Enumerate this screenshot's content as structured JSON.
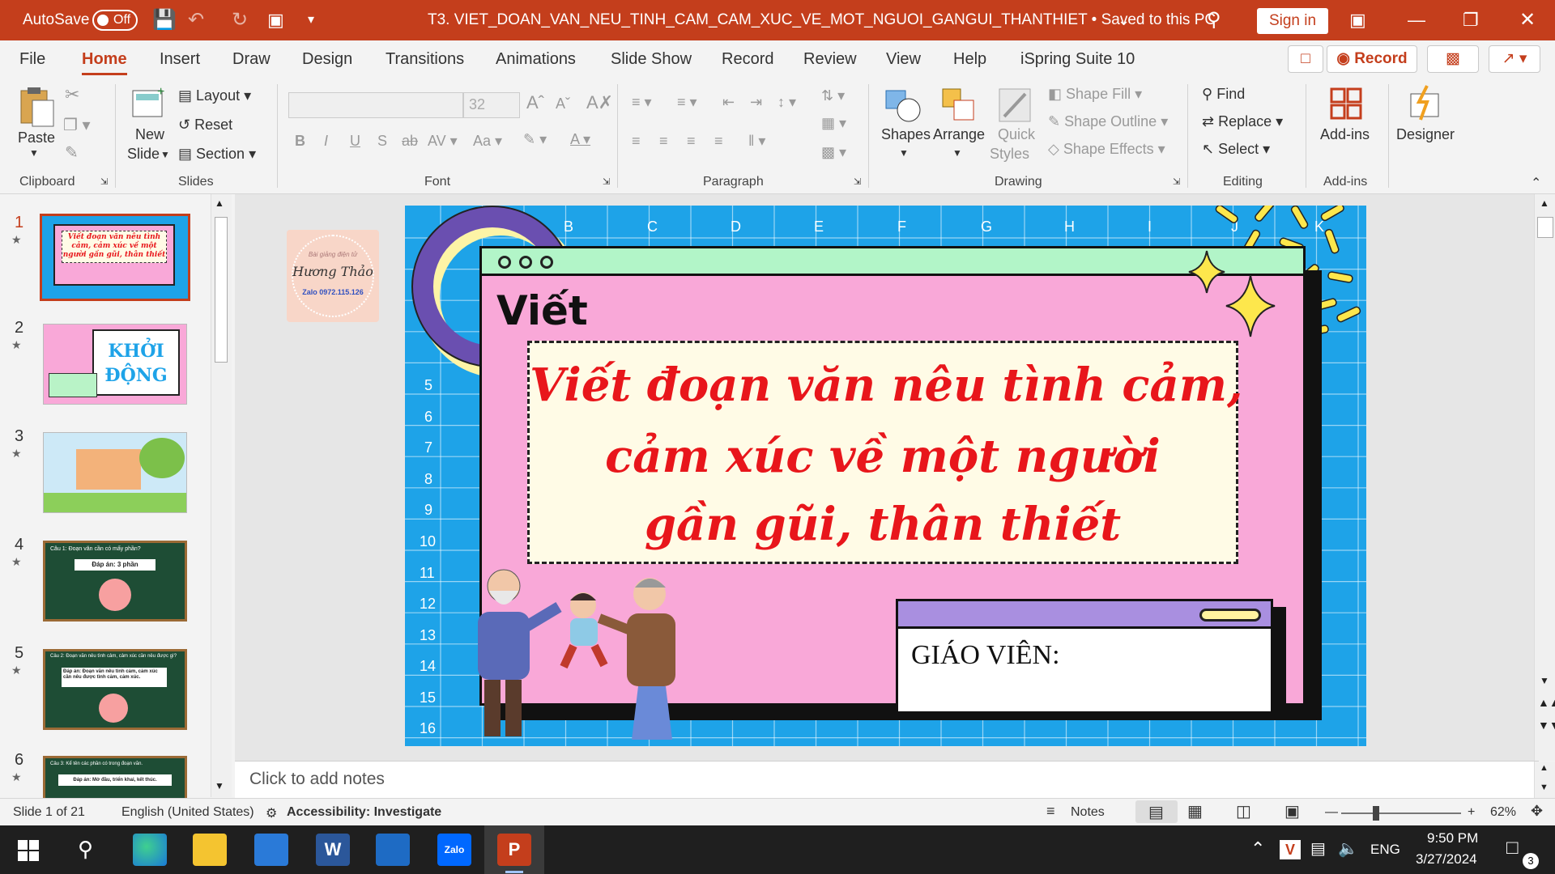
{
  "titlebar": {
    "autosave_label": "AutoSave",
    "autosave_state": "Off",
    "doc_title": "T3. VIET_DOAN_VAN_NEU_TINH_CAM_CAM_XUC_VE_MOT_NGUOI_GANGUI_THANTHIET • Saved to this PC",
    "signin_label": "Sign in"
  },
  "tabs": [
    "File",
    "Home",
    "Insert",
    "Draw",
    "Design",
    "Transitions",
    "Animations",
    "Slide Show",
    "Record",
    "Review",
    "View",
    "Help",
    "iSpring Suite 10"
  ],
  "tab_buttons": {
    "record_label": "Record"
  },
  "ribbon": {
    "clipboard": {
      "paste": "Paste",
      "group": "Clipboard"
    },
    "slides": {
      "new_slide_1": "New",
      "new_slide_2": "Slide",
      "layout": "Layout",
      "reset": "Reset",
      "section": "Section",
      "group": "Slides"
    },
    "font": {
      "size": "32",
      "group": "Font"
    },
    "paragraph": {
      "group": "Paragraph"
    },
    "drawing": {
      "shapes": "Shapes",
      "arrange": "Arrange",
      "quick_styles_1": "Quick",
      "quick_styles_2": "Styles",
      "shape_fill": "Shape Fill",
      "shape_outline": "Shape Outline",
      "shape_effects": "Shape Effects",
      "group": "Drawing"
    },
    "editing": {
      "find": "Find",
      "replace": "Replace",
      "select": "Select",
      "group": "Editing"
    },
    "addins": {
      "addins": "Add-ins",
      "group": "Add-ins"
    },
    "designer": {
      "designer": "Designer"
    }
  },
  "thumbnails": [
    {
      "num": "1",
      "text": "Viết đoạn văn nêu tình cảm, cảm xúc về một người gần gũi, thân thiết"
    },
    {
      "num": "2",
      "text": "KHỞI ĐỘNG"
    },
    {
      "num": "3",
      "text": ""
    },
    {
      "num": "4",
      "text": "Câu 1: Đoạn văn cần có mấy phần?",
      "answer": "Đáp án: 3 phần"
    },
    {
      "num": "5",
      "text": "Câu 2: Đoạn văn nêu tình cảm, cảm xúc cần nêu được gì?",
      "answer": "Đáp án: Đoạn văn nêu tình cảm, cảm xúc cần nêu được tình cảm, cảm xúc."
    },
    {
      "num": "6",
      "text": "Câu 3: Kể tên các phần có trong đoạn văn.",
      "answer": "Đáp án: Mở đầu, triển khai, kết thúc."
    }
  ],
  "slide": {
    "logo_line1": "Bài giảng điện tử",
    "logo_name": "Hương Thảo",
    "logo_zalo": "Zalo 0972.115.126",
    "col_letters": [
      "B",
      "C",
      "D",
      "E",
      "F",
      "G",
      "H",
      "I",
      "J",
      "K"
    ],
    "row_numbers": [
      "5",
      "6",
      "7",
      "8",
      "9",
      "10",
      "11",
      "12",
      "13",
      "14",
      "15",
      "16"
    ],
    "heading": "Viết",
    "title_line1": "Viết đoạn văn nêu tình cảm,",
    "title_line2": "cảm xúc về một người",
    "title_line3": "gần gũi, thân thiết",
    "teacher_label": "GIÁO VIÊN:"
  },
  "notes_placeholder": "Click to add notes",
  "status": {
    "slide_info": "Slide 1 of 21",
    "language": "English (United States)",
    "accessibility": "Accessibility: Investigate",
    "notes": "Notes",
    "zoom": "62%"
  },
  "taskbar": {
    "time": "9:50 PM",
    "date": "3/27/2024",
    "lang": "ENG",
    "notif_count": "3"
  },
  "colors": {
    "accent": "#c43e1c",
    "slide_bg": "#1ea3e8",
    "slide_pink": "#f9a8d8",
    "title_red": "#e8161b"
  }
}
